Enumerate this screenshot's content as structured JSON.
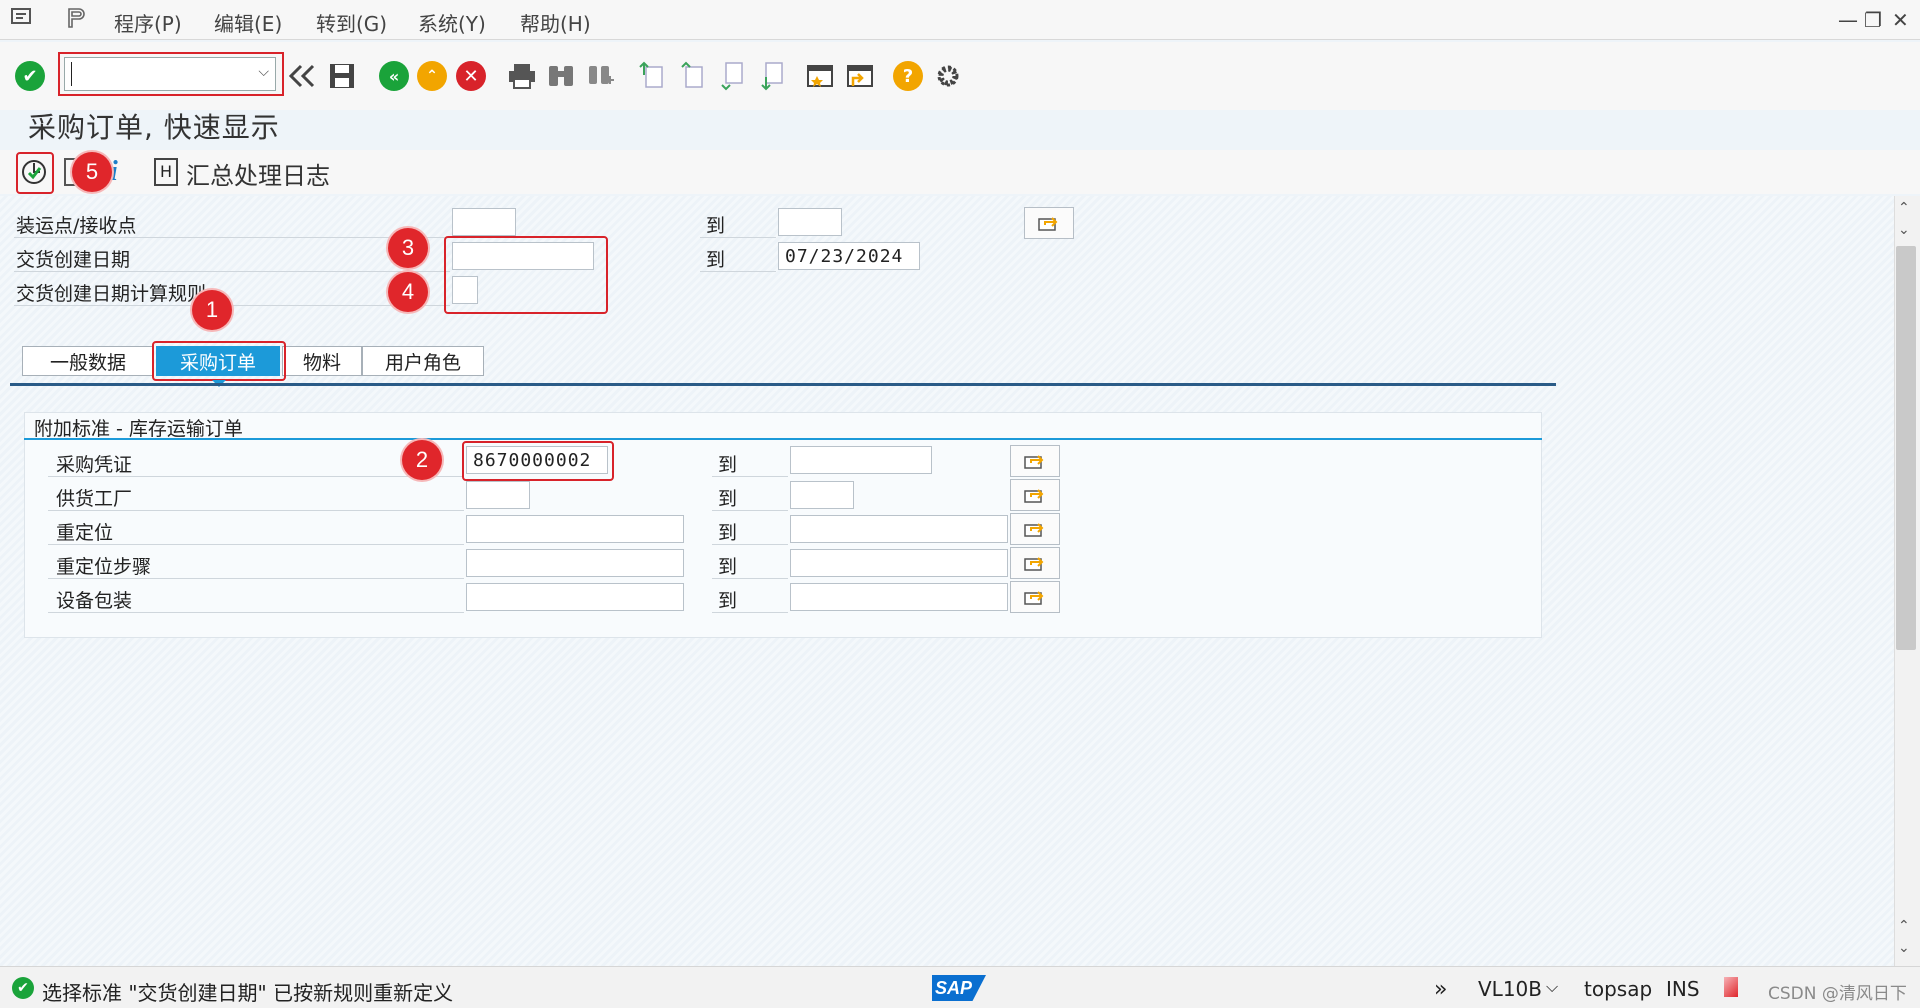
{
  "menu": {
    "items": [
      "程序(P)",
      "编辑(E)",
      "转到(G)",
      "系统(Y)",
      "帮助(H)"
    ]
  },
  "window": {
    "minimize": "—",
    "restore": "❐",
    "close": "✕"
  },
  "toolbar": {
    "command_value": ""
  },
  "page": {
    "title": "采购订单, 快速显示",
    "log_button": "汇总处理日志"
  },
  "selection": {
    "rows": [
      {
        "label": "装运点/接收点",
        "from": "",
        "to_label": "到",
        "to": ""
      },
      {
        "label": "交货创建日期",
        "from": "",
        "to_label": "到",
        "to": "07/23/2024"
      },
      {
        "label": "交货创建日期计算规则",
        "from": ""
      }
    ]
  },
  "tabs": [
    "一般数据",
    "采购订单",
    "物料",
    "用户角色"
  ],
  "active_tab": "采购订单",
  "group": {
    "title": "附加标准 - 库存运输订单",
    "rows": [
      {
        "label": "采购凭证",
        "from": "8670000002",
        "to_label": "到",
        "to": ""
      },
      {
        "label": "供货工厂",
        "from": "",
        "to_label": "到",
        "to": ""
      },
      {
        "label": "重定位",
        "from": "",
        "to_label": "到",
        "to": ""
      },
      {
        "label": "重定位步骤",
        "from": "",
        "to_label": "到",
        "to": ""
      },
      {
        "label": "设备包装",
        "from": "",
        "to_label": "到",
        "to": ""
      }
    ]
  },
  "annotations": [
    "1",
    "2",
    "3",
    "4",
    "5"
  ],
  "status": {
    "message": "选择标准 \"交货创建日期\" 已按新规则重新定义",
    "brand": "SAP",
    "transaction": "VL10B",
    "system": "topsap",
    "mode": "INS",
    "watermark": "CSDN @清风日下"
  },
  "colors": {
    "accent": "#1c9ad9",
    "annotation_red": "#e0262b",
    "ok_green": "#1aa33a",
    "nav_orange": "#f2a500",
    "cancel_red": "#d8232a"
  },
  "icons": [
    "sap-menu-icon",
    "enter-icon",
    "save-icon",
    "back-icon",
    "exit-icon",
    "cancel-icon",
    "print-icon",
    "find-icon",
    "find-next-icon",
    "first-page-icon",
    "previous-page-icon",
    "next-page-icon",
    "last-page-icon",
    "create-session-icon",
    "shortcut-icon",
    "help-icon",
    "settings-icon",
    "execute-icon",
    "info-icon",
    "log-icon",
    "multiple-selection-icon"
  ]
}
